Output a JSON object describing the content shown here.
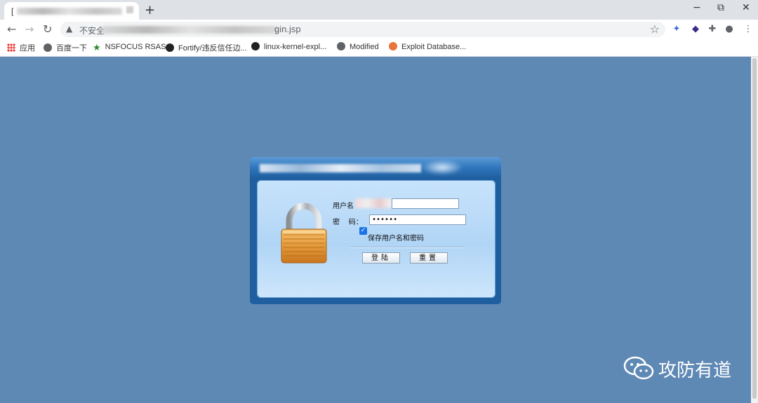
{
  "browser": {
    "tab": {
      "title_prefix": "["
    },
    "new_tab": "+",
    "window": {
      "minimize": "−",
      "restore": "⧉",
      "close": "✕"
    },
    "nav": {
      "back": "←",
      "forward": "→",
      "reload": "↻"
    },
    "address": {
      "security": "不安全",
      "url_tail": "gin.jsp"
    },
    "bookmarks": [
      {
        "label": "应用",
        "icon": "apps-icon"
      },
      {
        "label": "百度一下",
        "icon": "globe-icon"
      },
      {
        "label": "NSFOCUS RSAS",
        "icon": "star-icon"
      },
      {
        "label": "Fortify/违反信任边...",
        "icon": "github-icon"
      },
      {
        "label": "linux-kernel-expl...",
        "icon": "github-icon"
      },
      {
        "label": "Modified",
        "icon": "globe-icon"
      },
      {
        "label": "Exploit Database...",
        "icon": "exploit-icon"
      }
    ]
  },
  "login": {
    "username_label": "用户名",
    "password_label": "密    码：",
    "password_value": "••••••",
    "remember_label": "保存用户名和密码",
    "remember_checked": true,
    "login_button": "登陆",
    "reset_button": "重置"
  },
  "watermark": {
    "text": "攻防有道"
  },
  "colors": {
    "page_bg": "#5f89b5",
    "dialog_frame": "#1f5f9f",
    "dialog_panel": "#b1d5f6"
  }
}
